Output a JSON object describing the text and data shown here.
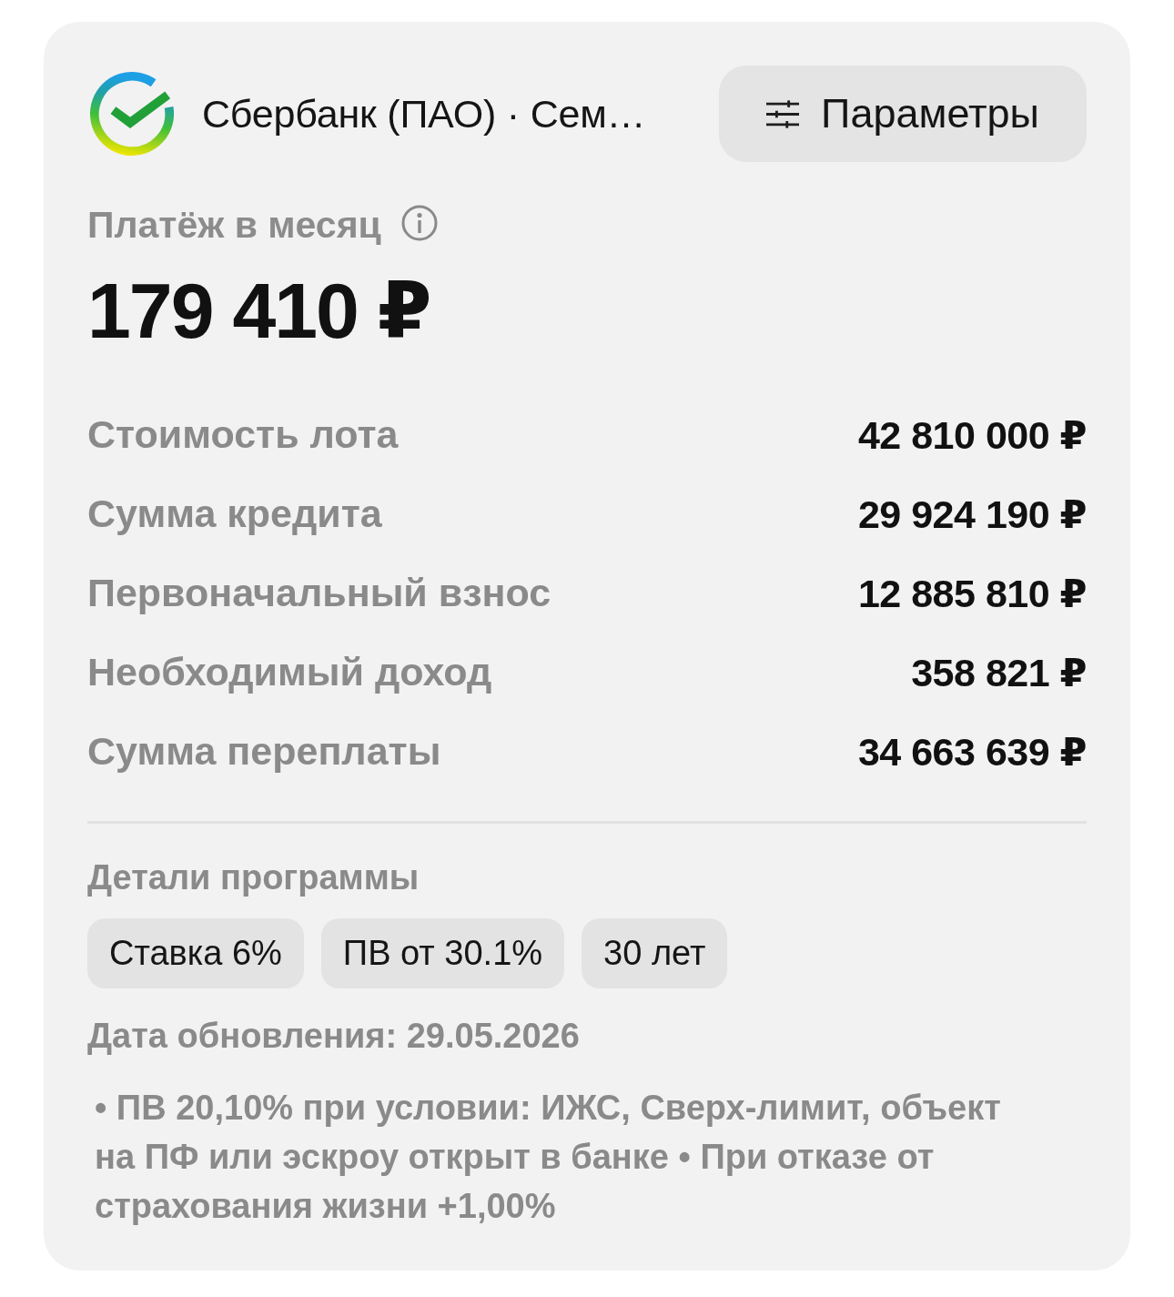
{
  "header": {
    "bank_name": "Сбербанк (ПАО) · Сем…",
    "params_button": "Параметры"
  },
  "payment": {
    "label": "Платёж в месяц",
    "amount": "179 410 ₽"
  },
  "details": [
    {
      "label": "Стоимость лота",
      "value": "42 810 000 ₽"
    },
    {
      "label": "Сумма кредита",
      "value": "29 924 190 ₽"
    },
    {
      "label": "Первоначальный взнос",
      "value": "12 885 810 ₽"
    },
    {
      "label": "Необходимый доход",
      "value": "358 821 ₽"
    },
    {
      "label": "Сумма переплаты",
      "value": "34 663 639 ₽"
    }
  ],
  "program": {
    "title": "Детали программы",
    "chips": [
      "Ставка 6%",
      "ПВ от 30.1%",
      "30 лет"
    ],
    "updated": "Дата обновления: 29.05.2026",
    "note": "• ПВ 20,10% при условии: ИЖС, Сверх-лимит, объект на ПФ или эскроу открыт в банке • При отказе от страхования жизни +1,00%"
  }
}
